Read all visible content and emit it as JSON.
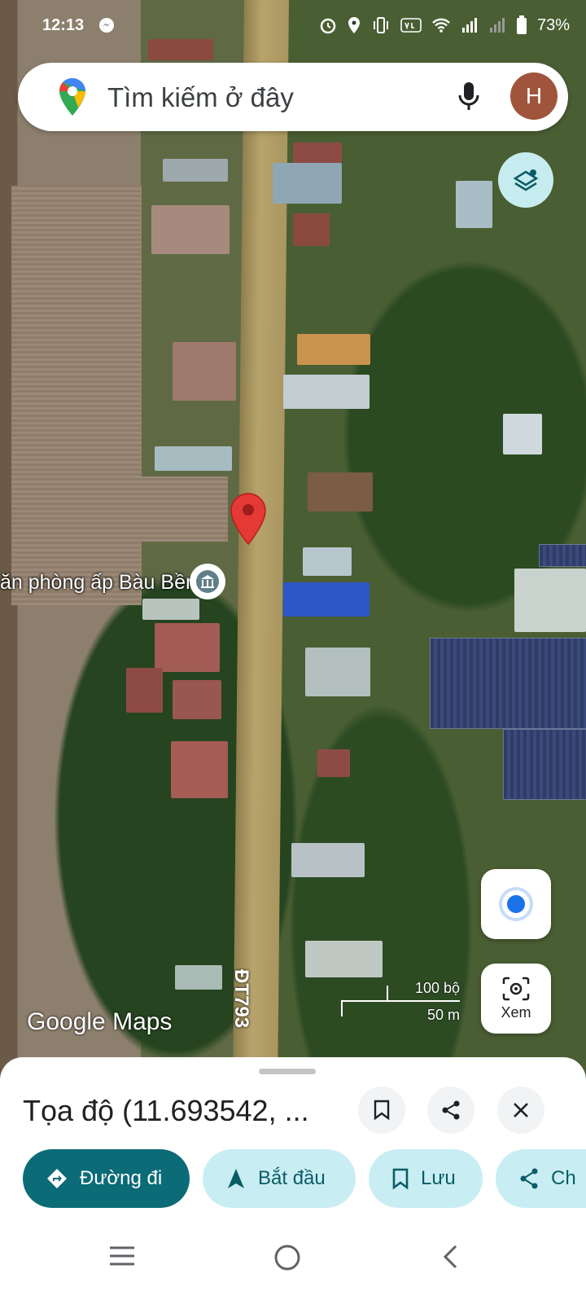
{
  "status_bar": {
    "time": "12:13",
    "battery": "73%"
  },
  "search": {
    "placeholder": "Tìm kiếm ở đây",
    "avatar_letter": "H"
  },
  "map": {
    "poi_label": "ăn phòng ấp Bàu Bền",
    "road_label": "ĐT793",
    "scale_top": "100 bộ",
    "scale_bottom": "50 m",
    "attribution": "Google Maps",
    "lens_label": "Xem"
  },
  "sheet": {
    "title": "Tọa độ (11.693542, ...",
    "chips": [
      {
        "label": "Đường đi",
        "icon": "directions-icon"
      },
      {
        "label": "Bắt đầu",
        "icon": "navigation-arrow-icon"
      },
      {
        "label": "Lưu",
        "icon": "bookmark-icon"
      },
      {
        "label": "Ch",
        "icon": "share-icon"
      }
    ]
  },
  "colors": {
    "accent": "#0b6b76",
    "chip_bg": "#c8eef3",
    "pin": "#e53935"
  }
}
